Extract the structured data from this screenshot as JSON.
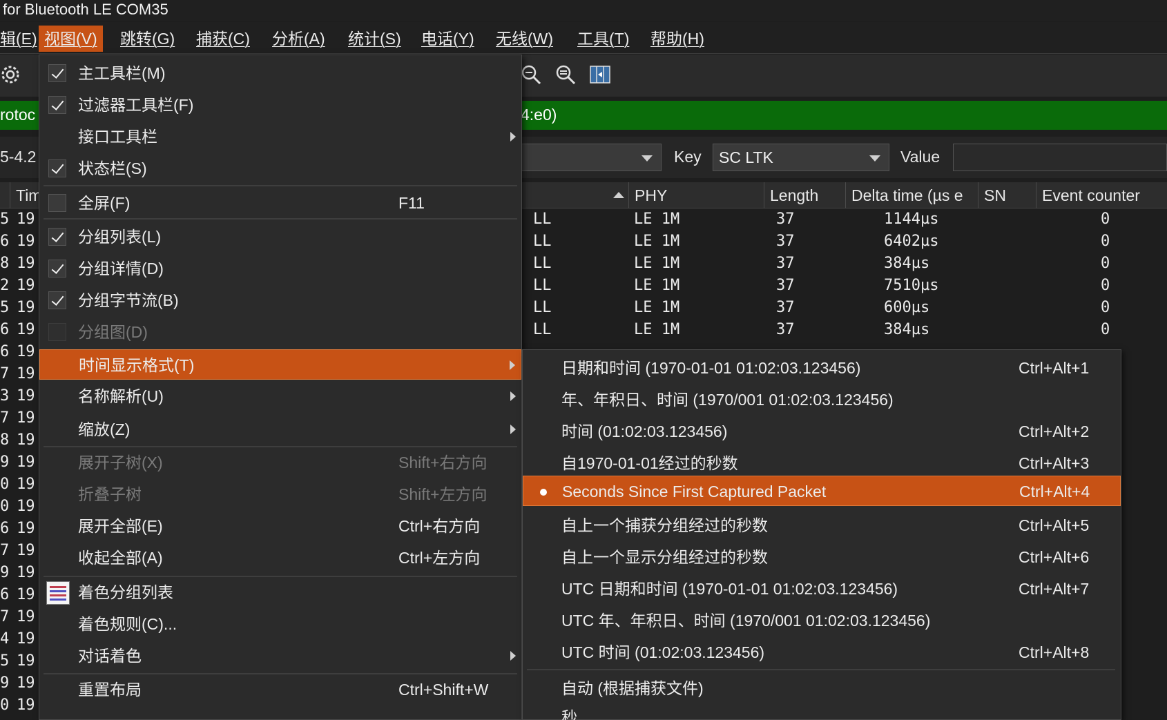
{
  "window": {
    "title": "for Bluetooth LE COM35"
  },
  "menubar": [
    {
      "label": "辑(E)"
    },
    {
      "label": "视图(V)"
    },
    {
      "label": "跳转(G)"
    },
    {
      "label": "捕获(C)"
    },
    {
      "label": "分析(A)"
    },
    {
      "label": "统计(S)"
    },
    {
      "label": "电话(Y)"
    },
    {
      "label": "无线(W)"
    },
    {
      "label": "工具(T)"
    },
    {
      "label": "帮助(H)"
    }
  ],
  "toolbar": {
    "icons": [
      "gear-icon",
      "zoom-in-icon",
      "zoom-out-icon",
      "resize-columns-icon"
    ]
  },
  "filter": {
    "left_text": "rotoc",
    "right_text": "4:e0)"
  },
  "kvbar": {
    "left_text": "5-4.2",
    "key_label": "Key",
    "key_value": "SC LTK",
    "value_label": "Value",
    "value_input": ""
  },
  "packet_list": {
    "columns": [
      "Tim",
      "PHY",
      "Length",
      "Delta time (µs e",
      "SN",
      "Event counter"
    ],
    "left_fragments": [
      {
        "no": "5",
        "time": "19"
      },
      {
        "no": "6",
        "time": "19"
      },
      {
        "no": "8",
        "time": "19"
      },
      {
        "no": "2",
        "time": "19"
      },
      {
        "no": "5",
        "time": "19"
      },
      {
        "no": "6",
        "time": "19"
      },
      {
        "no": "6",
        "time": "19"
      },
      {
        "no": "7",
        "time": "19"
      },
      {
        "no": "3",
        "time": "19"
      },
      {
        "no": "7",
        "time": "19"
      },
      {
        "no": "8",
        "time": "19"
      },
      {
        "no": "9",
        "time": "19"
      },
      {
        "no": "0",
        "time": "19"
      },
      {
        "no": "0",
        "time": "19"
      },
      {
        "no": "6",
        "time": "19"
      },
      {
        "no": "7",
        "time": "19"
      },
      {
        "no": "9",
        "time": "19"
      },
      {
        "no": "6",
        "time": "19"
      },
      {
        "no": "7",
        "time": "19"
      },
      {
        "no": "4",
        "time": "19"
      },
      {
        "no": "5",
        "time": "19"
      },
      {
        "no": "9",
        "time": "19"
      },
      {
        "no": "0",
        "time": "19"
      }
    ],
    "rows": [
      {
        "proto": "LL",
        "phy": "LE 1M",
        "length": "37",
        "delta": "1144µs",
        "event": "0"
      },
      {
        "proto": "LL",
        "phy": "LE 1M",
        "length": "37",
        "delta": "6402µs",
        "event": "0"
      },
      {
        "proto": "LL",
        "phy": "LE 1M",
        "length": "37",
        "delta": "384µs",
        "event": "0"
      },
      {
        "proto": "LL",
        "phy": "LE 1M",
        "length": "37",
        "delta": "7510µs",
        "event": "0"
      },
      {
        "proto": "LL",
        "phy": "LE 1M",
        "length": "37",
        "delta": "600µs",
        "event": "0"
      },
      {
        "proto": "LL",
        "phy": "LE 1M",
        "length": "37",
        "delta": "384µs",
        "event": "0"
      }
    ]
  },
  "view_menu": {
    "items": [
      {
        "label": "主工具栏(M)",
        "checked": true
      },
      {
        "label": "过滤器工具栏(F)",
        "checked": true
      },
      {
        "label": "接口工具栏",
        "submenu": true
      },
      {
        "label": "状态栏(S)",
        "checked": true
      },
      {
        "label": "全屏(F)",
        "shortcut": "F11",
        "checked": false
      },
      {
        "label": "分组列表(L)",
        "checked": true
      },
      {
        "label": "分组详情(D)",
        "checked": true
      },
      {
        "label": "分组字节流(B)",
        "checked": true
      },
      {
        "label": "分组图(D)",
        "disabled": true
      },
      {
        "label": "时间显示格式(T)",
        "submenu": true,
        "highlight": true
      },
      {
        "label": "名称解析(U)",
        "submenu": true
      },
      {
        "label": "缩放(Z)",
        "submenu": true
      },
      {
        "label": "展开子树(X)",
        "shortcut": "Shift+右方向",
        "disabled": true
      },
      {
        "label": "折叠子树",
        "shortcut": "Shift+左方向",
        "disabled": true
      },
      {
        "label": "展开全部(E)",
        "shortcut": "Ctrl+右方向"
      },
      {
        "label": "收起全部(A)",
        "shortcut": "Ctrl+左方向"
      },
      {
        "label": "着色分组列表"
      },
      {
        "label": "着色规则(C)..."
      },
      {
        "label": "对话着色",
        "submenu": true
      },
      {
        "label": "重置布局",
        "shortcut": "Ctrl+Shift+W"
      }
    ]
  },
  "time_menu": {
    "items": [
      {
        "label": "日期和时间 (1970-01-01 01:02:03.123456)",
        "shortcut": "Ctrl+Alt+1"
      },
      {
        "label": "年、年积日、时间 (1970/001 01:02:03.123456)",
        "shortcut": ""
      },
      {
        "label": "时间 (01:02:03.123456)",
        "shortcut": "Ctrl+Alt+2"
      },
      {
        "label": "自1970-01-01经过的秒数",
        "shortcut": "Ctrl+Alt+3"
      },
      {
        "label": "Seconds Since First Captured Packet",
        "shortcut": "Ctrl+Alt+4",
        "selected": true
      },
      {
        "label": "自上一个捕获分组经过的秒数",
        "shortcut": "Ctrl+Alt+5"
      },
      {
        "label": "自上一个显示分组经过的秒数",
        "shortcut": "Ctrl+Alt+6"
      },
      {
        "label": "UTC 日期和时间 (1970-01-01 01:02:03.123456)",
        "shortcut": "Ctrl+Alt+7"
      },
      {
        "label": "UTC 年、年积日、时间 (1970/001 01:02:03.123456)",
        "shortcut": ""
      },
      {
        "label": "UTC 时间 (01:02:03.123456)",
        "shortcut": "Ctrl+Alt+8"
      },
      {
        "label": "自动 (根据捕获文件)",
        "shortcut": ""
      },
      {
        "label": "秒",
        "shortcut": ""
      }
    ]
  },
  "colors": {
    "accent": "#c75215",
    "filter_ok": "#0a6b0a",
    "background": "#1e1e1e",
    "menu_bg": "#2b2b2b"
  }
}
